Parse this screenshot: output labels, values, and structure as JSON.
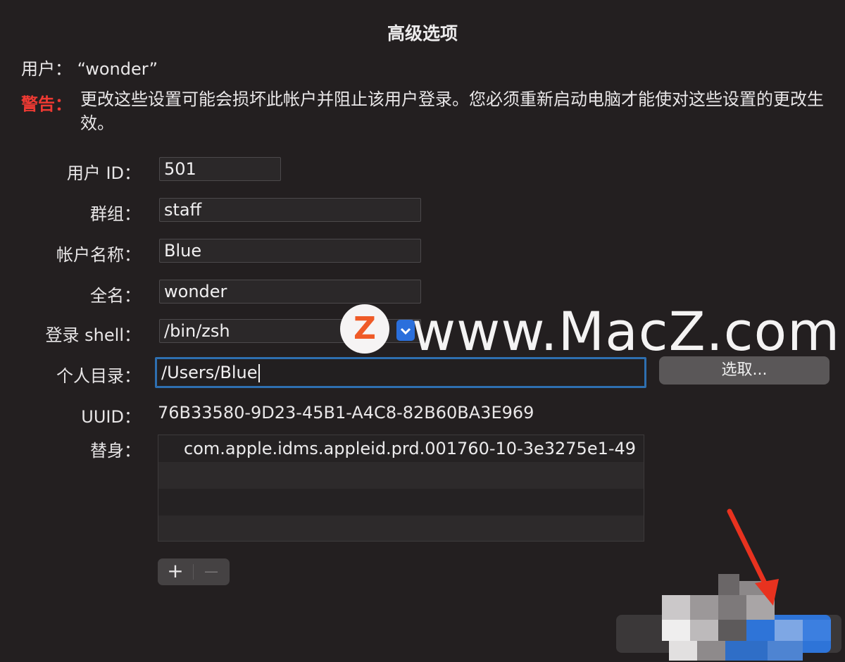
{
  "dialog": {
    "title": "高级选项",
    "user_label": "用户：",
    "user_value": "“wonder”",
    "warning_label": "警告：",
    "warning_text": "更改这些设置可能会损坏此帐户并阻止该用户登录。您必须重新启动电脑才能使对这些设置的更改生效。"
  },
  "fields": {
    "user_id": {
      "label": "用户 ID：",
      "value": "501"
    },
    "group": {
      "label": "群组：",
      "value": "staff"
    },
    "account_name": {
      "label": "帐户名称：",
      "value": "Blue"
    },
    "full_name": {
      "label": "全名：",
      "value": "wonder"
    },
    "login_shell": {
      "label": "登录 shell：",
      "value": "/bin/zsh"
    },
    "home_dir": {
      "label": "个人目录：",
      "value": "/Users/Blue"
    },
    "uuid": {
      "label": "UUID：",
      "value": "76B33580-9D23-45B1-A4C8-82B60BA3E969"
    },
    "aliases": {
      "label": "替身：",
      "items": [
        "com.apple.idms.appleid.prd.001760-10-3e3275e1-49"
      ]
    }
  },
  "buttons": {
    "choose": "选取...",
    "add": "+",
    "remove": "—"
  },
  "icons": {
    "popup": "chevron-down-icon",
    "annotation": "red-arrow-icon"
  },
  "watermark": {
    "logo_letter": "Z",
    "text": "www.MacZ.com"
  },
  "colors": {
    "background": "#231f20",
    "warning": "#ee3a33",
    "focus_ring": "#2e6fb0",
    "accent": "#2a6fdc",
    "annotation_arrow": "#e8321f"
  }
}
